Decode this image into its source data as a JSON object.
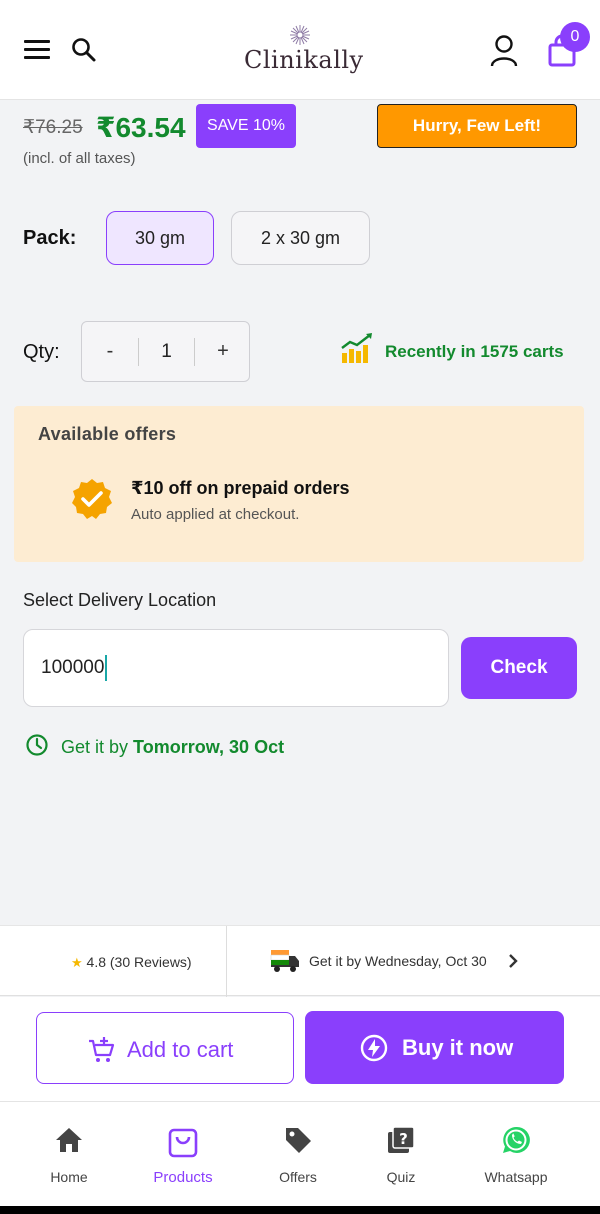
{
  "header": {
    "brand": "Clinikally",
    "cart_count": "0"
  },
  "price": {
    "original": "₹76.25",
    "current": "₹63.54",
    "save_badge": "SAVE 10%",
    "stock_badge": "Hurry, Few Left!",
    "tax_note": "(incl. of all taxes)"
  },
  "pack": {
    "label": "Pack:",
    "options": [
      {
        "label": "30 gm",
        "selected": true
      },
      {
        "label": "2 x 30 gm",
        "selected": false
      }
    ]
  },
  "quantity": {
    "label": "Qty:",
    "minus": "-",
    "value": "1",
    "plus": "+",
    "carts_text": "Recently in 1575 carts"
  },
  "offers": {
    "title": "Available offers",
    "items": [
      {
        "title": "₹10 off on prepaid orders",
        "subtitle": "Auto applied at checkout."
      }
    ]
  },
  "delivery": {
    "label": "Select Delivery Location",
    "pincode_value": "100000",
    "check_label": "Check",
    "eta_prefix": "Get it by",
    "eta_date": "Tomorrow, 30 Oct"
  },
  "info_strip": {
    "rating": "4.8 (30 Reviews)",
    "shipping": "Get it by Wednesday, Oct 30"
  },
  "actions": {
    "add_to_cart": "Add to cart",
    "buy_now": "Buy it now"
  },
  "bottom_nav": {
    "items": [
      {
        "label": "Home",
        "icon": "home-icon"
      },
      {
        "label": "Products",
        "icon": "bag-icon",
        "active": true
      },
      {
        "label": "Offers",
        "icon": "tag-icon"
      },
      {
        "label": "Quiz",
        "icon": "quiz-icon"
      },
      {
        "label": "Whatsapp",
        "icon": "whatsapp-icon"
      }
    ]
  },
  "colors": {
    "accent": "#8a3ffc",
    "price_green": "#138a2e",
    "warning_orange": "#ff9800",
    "offer_bg": "#fdecd2"
  }
}
